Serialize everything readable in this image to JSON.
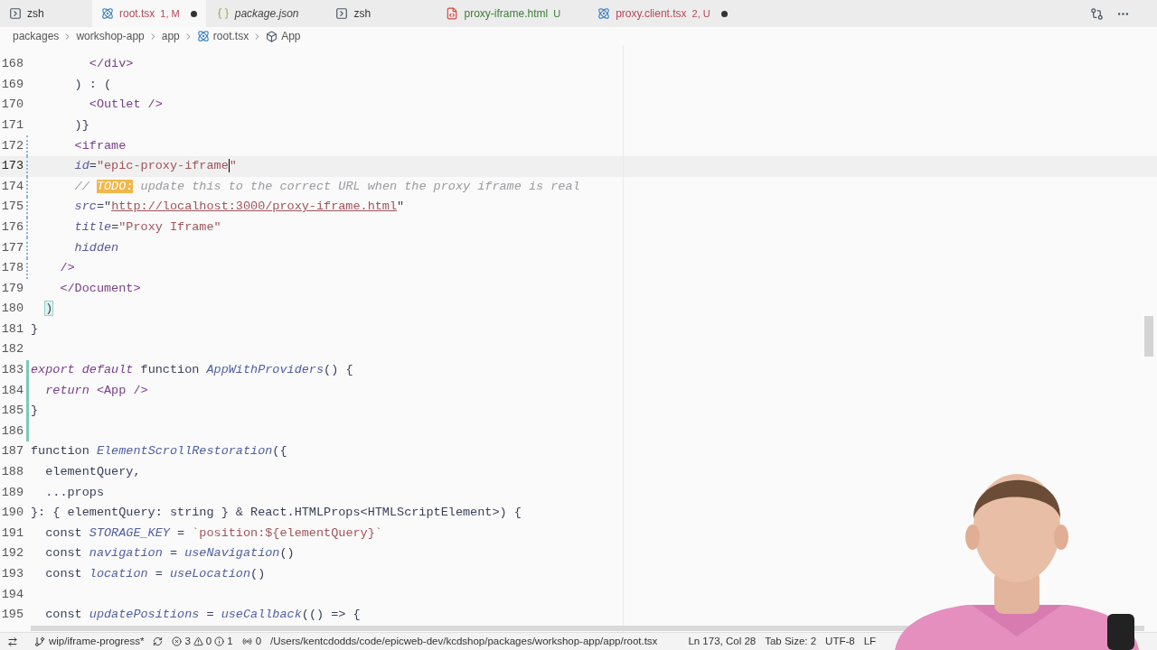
{
  "tabs": [
    {
      "kind": "terminal",
      "label": "zsh",
      "color": "#333333",
      "italic": false,
      "dirty": false,
      "selected": false
    },
    {
      "kind": "react",
      "label": "root.tsx",
      "status": "1, M",
      "color": "#b5485a",
      "italic": false,
      "dirty": true,
      "selected": true
    },
    {
      "kind": "json",
      "label": "package.json",
      "color": "#444444",
      "italic": true,
      "dirty": false,
      "selected": false
    },
    {
      "kind": "terminal",
      "label": "zsh",
      "color": "#333333",
      "italic": false,
      "dirty": false,
      "selected": false
    },
    {
      "kind": "html",
      "label": "proxy-iframe.html",
      "status": "U",
      "color": "#3f7d3a",
      "italic": false,
      "dirty": false,
      "selected": false
    },
    {
      "kind": "react",
      "label": "proxy.client.tsx",
      "status": "2, U",
      "color": "#b5485a",
      "italic": false,
      "dirty": true,
      "selected": false
    }
  ],
  "breadcrumbs": [
    {
      "kind": "folder",
      "label": "packages"
    },
    {
      "kind": "folder",
      "label": "workshop-app"
    },
    {
      "kind": "folder",
      "label": "app"
    },
    {
      "kind": "react",
      "label": "root.tsx"
    },
    {
      "kind": "symbol",
      "label": "App"
    }
  ],
  "lines": [
    {
      "number": "168",
      "kind": "plain",
      "current": false,
      "tokens": [
        {
          "kind": "tag",
          "text": "        </div>"
        }
      ]
    },
    {
      "number": "169",
      "kind": "plain",
      "current": false,
      "tokens": [
        {
          "kind": "plain",
          "text": "      ) : ("
        }
      ]
    },
    {
      "number": "170",
      "kind": "plain",
      "current": false,
      "tokens": [
        {
          "kind": "tag",
          "text": "        <Outlet />"
        }
      ]
    },
    {
      "number": "171",
      "kind": "plain",
      "current": false,
      "tokens": [
        {
          "kind": "plain",
          "text": "      )}"
        }
      ]
    },
    {
      "number": "172",
      "kind": "modified",
      "current": false,
      "tokens": [
        {
          "kind": "tag",
          "text": "      <iframe"
        }
      ]
    },
    {
      "number": "173",
      "kind": "modified",
      "current": true,
      "tokens": [
        {
          "kind": "attr",
          "text": "      id"
        },
        {
          "kind": "plain",
          "text": "="
        },
        {
          "kind": "string",
          "text": "\"epic-proxy-iframe"
        },
        {
          "kind": "cursor",
          "text": "\""
        }
      ]
    },
    {
      "number": "174",
      "kind": "modified",
      "current": false,
      "tokens": [
        {
          "kind": "comment",
          "text": "      // "
        },
        {
          "kind": "todo",
          "text": "TODO:"
        },
        {
          "kind": "comment",
          "text": " update this to the correct URL when the proxy iframe is real"
        }
      ]
    },
    {
      "number": "175",
      "kind": "modified",
      "current": false,
      "tokens": [
        {
          "kind": "attr",
          "text": "      src"
        },
        {
          "kind": "plain",
          "text": "=\""
        },
        {
          "kind": "link",
          "text": "http://localhost:3000/proxy-iframe.html"
        },
        {
          "kind": "plain",
          "text": "\""
        }
      ]
    },
    {
      "number": "176",
      "kind": "modified",
      "current": false,
      "tokens": [
        {
          "kind": "attr",
          "text": "      title"
        },
        {
          "kind": "plain",
          "text": "="
        },
        {
          "kind": "string",
          "text": "\"Proxy Iframe\""
        }
      ]
    },
    {
      "number": "177",
      "kind": "modified",
      "current": false,
      "tokens": [
        {
          "kind": "attr",
          "text": "      hidden"
        }
      ]
    },
    {
      "number": "178",
      "kind": "modified",
      "current": false,
      "tokens": [
        {
          "kind": "tag",
          "text": "    />"
        }
      ]
    },
    {
      "number": "179",
      "kind": "plain",
      "current": false,
      "tokens": [
        {
          "kind": "tag",
          "text": "    </Document>"
        }
      ]
    },
    {
      "number": "180",
      "kind": "plain",
      "current": false,
      "tokens": [
        {
          "kind": "bracket",
          "text": "  )"
        }
      ]
    },
    {
      "number": "181",
      "kind": "plain",
      "current": false,
      "tokens": [
        {
          "kind": "plain",
          "text": "}"
        }
      ]
    },
    {
      "number": "182",
      "kind": "plain",
      "current": false
    },
    {
      "number": "183",
      "kind": "added",
      "current": false,
      "tokens": [
        {
          "kind": "keyword",
          "text": "export default "
        },
        {
          "kind": "plain",
          "text": "function "
        },
        {
          "kind": "func",
          "text": "AppWithProviders"
        },
        {
          "kind": "plain",
          "text": "() {"
        }
      ]
    },
    {
      "number": "184",
      "kind": "added",
      "current": false,
      "tokens": [
        {
          "kind": "keyword",
          "text": "  return "
        },
        {
          "kind": "tag",
          "text": "<App />"
        }
      ]
    },
    {
      "number": "185",
      "kind": "added",
      "current": false,
      "tokens": [
        {
          "kind": "plain",
          "text": "}"
        }
      ]
    },
    {
      "number": "186",
      "kind": "added",
      "current": false
    },
    {
      "number": "187",
      "kind": "plain",
      "current": false,
      "tokens": [
        {
          "kind": "plain",
          "text": "function "
        },
        {
          "kind": "func",
          "text": "ElementScrollRestoration"
        },
        {
          "kind": "plain",
          "text": "({"
        }
      ]
    },
    {
      "number": "188",
      "kind": "plain",
      "current": false,
      "tokens": [
        {
          "kind": "plain",
          "text": "  elementQuery,"
        }
      ]
    },
    {
      "number": "189",
      "kind": "plain",
      "current": false,
      "tokens": [
        {
          "kind": "plain",
          "text": "  ...props"
        }
      ]
    },
    {
      "number": "190",
      "kind": "plain",
      "current": false,
      "tokens": [
        {
          "kind": "plain",
          "text": "}: { elementQuery: string } & React.HTMLProps<HTMLScriptElement>) {"
        }
      ]
    },
    {
      "number": "191",
      "kind": "plain",
      "current": false,
      "tokens": [
        {
          "kind": "plain",
          "text": "  const "
        },
        {
          "kind": "var",
          "text": "STORAGE_KEY"
        },
        {
          "kind": "plain",
          "text": " = "
        },
        {
          "kind": "string",
          "text": "`position:${elementQuery}`"
        }
      ]
    },
    {
      "number": "192",
      "kind": "plain",
      "current": false,
      "tokens": [
        {
          "kind": "plain",
          "text": "  const "
        },
        {
          "kind": "var",
          "text": "navigation"
        },
        {
          "kind": "plain",
          "text": " = "
        },
        {
          "kind": "func",
          "text": "useNavigation"
        },
        {
          "kind": "plain",
          "text": "()"
        }
      ]
    },
    {
      "number": "193",
      "kind": "plain",
      "current": false,
      "tokens": [
        {
          "kind": "plain",
          "text": "  const "
        },
        {
          "kind": "var",
          "text": "location"
        },
        {
          "kind": "plain",
          "text": " = "
        },
        {
          "kind": "func",
          "text": "useLocation"
        },
        {
          "kind": "plain",
          "text": "()"
        }
      ]
    },
    {
      "number": "194",
      "kind": "plain",
      "current": false
    },
    {
      "number": "195",
      "kind": "plain",
      "current": false,
      "tokens": [
        {
          "kind": "plain",
          "text": "  const "
        },
        {
          "kind": "var",
          "text": "updatePositions"
        },
        {
          "kind": "plain",
          "text": " = "
        },
        {
          "kind": "func",
          "text": "useCallback"
        },
        {
          "kind": "plain",
          "text": "(() => {"
        }
      ]
    }
  ],
  "status_bar": {
    "branch": "wip/iframe-progress*",
    "errors": "3",
    "warnings": "0",
    "infos": "1",
    "ports": "0",
    "path": "/Users/kentcdodds/code/epicweb-dev/kcdshop/packages/workshop-app/app/root.tsx",
    "position": "Ln 173, Col 28",
    "tab_size": "Tab Size: 2",
    "encoding": "UTF-8",
    "eol": "LF"
  }
}
